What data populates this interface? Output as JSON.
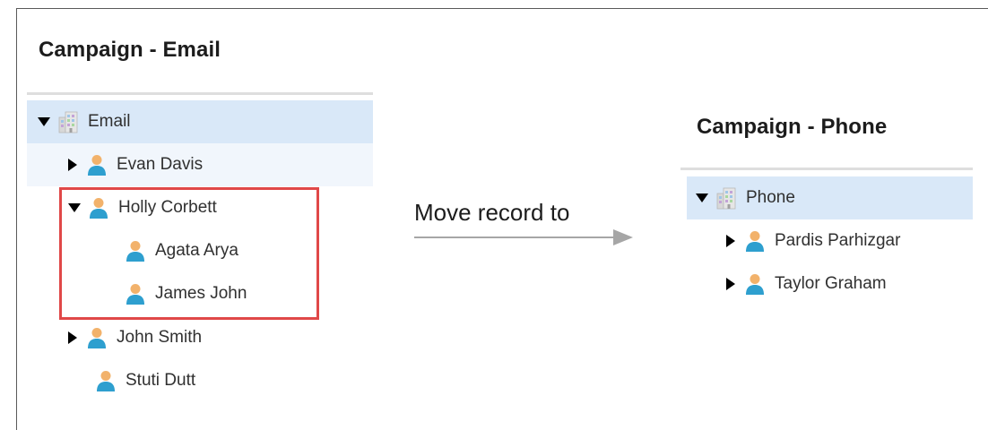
{
  "email_panel": {
    "title": "Campaign - Email",
    "tree": {
      "root": {
        "label": "Email",
        "icon": "building-icon",
        "expanded": true
      },
      "nodes": [
        {
          "label": "Evan Davis",
          "icon": "person-icon",
          "expandable": true,
          "expanded": false
        },
        {
          "label": "Holly Corbett",
          "icon": "person-icon",
          "expandable": true,
          "expanded": true,
          "children": [
            {
              "label": "Agata Arya",
              "icon": "person-icon"
            },
            {
              "label": "James John",
              "icon": "person-icon"
            }
          ]
        },
        {
          "label": "John Smith",
          "icon": "person-icon",
          "expandable": true,
          "expanded": false
        },
        {
          "label": "Stuti Dutt",
          "icon": "person-icon",
          "expandable": false
        }
      ]
    }
  },
  "action": {
    "label": "Move record to",
    "highlight_color": "#e04848"
  },
  "phone_panel": {
    "title": "Campaign - Phone",
    "tree": {
      "root": {
        "label": "Phone",
        "icon": "building-icon",
        "expanded": true
      },
      "nodes": [
        {
          "label": "Pardis Parhizgar",
          "icon": "person-icon",
          "expandable": true,
          "expanded": false
        },
        {
          "label": "Taylor Graham",
          "icon": "person-icon",
          "expandable": true,
          "expanded": false
        }
      ]
    }
  },
  "colors": {
    "selected_row": "#d9e8f8",
    "person_head": "#f2b26b",
    "person_body": "#2e9fcf"
  }
}
